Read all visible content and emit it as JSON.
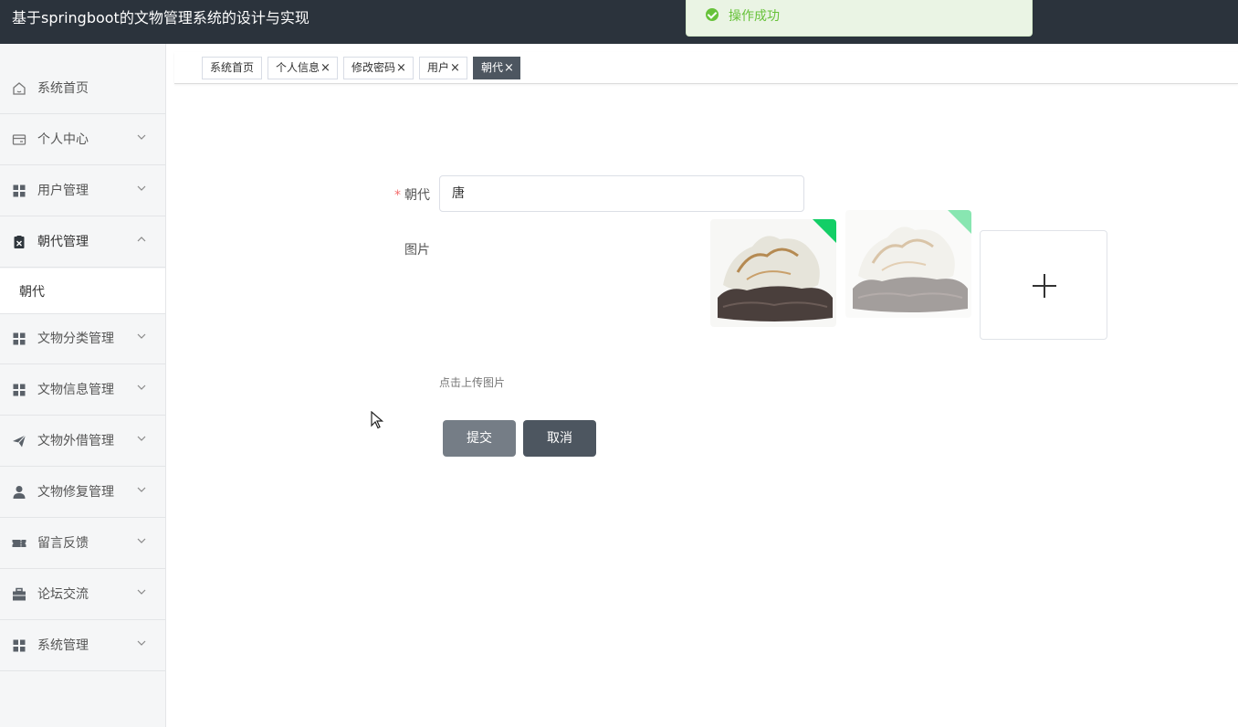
{
  "app": {
    "title": "基于springboot的文物管理系统的设计与实现"
  },
  "toast": {
    "text": "操作成功",
    "icon": "check-circle-icon",
    "color": "#67c23a"
  },
  "sidebar": {
    "items": [
      {
        "label": "系统首页",
        "icon": "home-icon"
      },
      {
        "label": "个人中心",
        "icon": "wallet-icon",
        "expandable": true
      },
      {
        "label": "用户管理",
        "icon": "grid-icon",
        "expandable": true
      },
      {
        "label": "朝代管理",
        "icon": "clipboard-icon",
        "expandable": true,
        "expanded": true
      },
      {
        "label": "文物分类管理",
        "icon": "grid-icon",
        "expandable": true
      },
      {
        "label": "文物信息管理",
        "icon": "grid-icon",
        "expandable": true
      },
      {
        "label": "文物外借管理",
        "icon": "send-icon",
        "expandable": true
      },
      {
        "label": "文物修复管理",
        "icon": "user-icon",
        "expandable": true
      },
      {
        "label": "留言反馈",
        "icon": "ticket-icon",
        "expandable": true
      },
      {
        "label": "论坛交流",
        "icon": "briefcase-icon",
        "expandable": true
      },
      {
        "label": "系统管理",
        "icon": "grid-icon",
        "expandable": true
      }
    ],
    "submenu": {
      "label": "朝代"
    }
  },
  "tabs": [
    {
      "label": "系统首页",
      "closable": false,
      "active": false
    },
    {
      "label": "个人信息",
      "closable": true,
      "active": false
    },
    {
      "label": "修改密码",
      "closable": true,
      "active": false
    },
    {
      "label": "用户",
      "closable": true,
      "active": false
    },
    {
      "label": "朝代",
      "closable": true,
      "active": true
    }
  ],
  "tab_close_glyph": "×",
  "form": {
    "dynasty_label": "朝代",
    "required_mark": "*",
    "dynasty_value": "唐",
    "image_label": "图片",
    "upload_hint": "点击上传图片",
    "submit_label": "提交",
    "cancel_label": "取消",
    "upload_icon": "plus-icon"
  }
}
